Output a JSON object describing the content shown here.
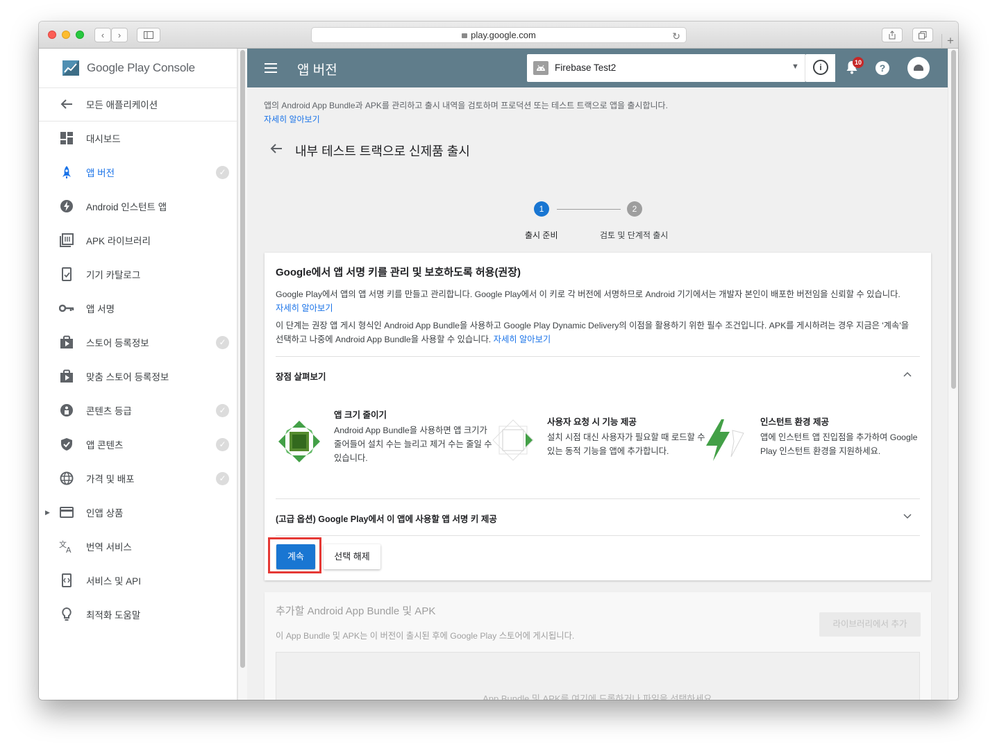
{
  "browser": {
    "url": "play.google.com"
  },
  "sidebar": {
    "logo_text": "Google Play Console",
    "back_label": "모든 애플리케이션",
    "items": [
      {
        "label": "대시보드",
        "icon": "dashboard-icon",
        "checked": false,
        "active": false
      },
      {
        "label": "앱 버전",
        "icon": "rocket-icon",
        "checked": true,
        "active": true
      },
      {
        "label": "Android 인스턴트 앱",
        "icon": "bolt-icon",
        "checked": false,
        "active": false
      },
      {
        "label": "APK 라이브러리",
        "icon": "library-icon",
        "checked": false,
        "active": false
      },
      {
        "label": "기기 카탈로그",
        "icon": "device-catalog-icon",
        "checked": false,
        "active": false
      },
      {
        "label": "앱 서명",
        "icon": "key-icon",
        "checked": false,
        "active": false
      },
      {
        "label": "스토어 등록정보",
        "icon": "store-icon",
        "checked": true,
        "active": false
      },
      {
        "label": "맞춤 스토어 등록정보",
        "icon": "store-icon",
        "checked": false,
        "active": false
      },
      {
        "label": "콘텐츠 등급",
        "icon": "content-rating-icon",
        "checked": true,
        "active": false
      },
      {
        "label": "앱 콘텐츠",
        "icon": "shield-icon",
        "checked": true,
        "active": false
      },
      {
        "label": "가격 및 배포",
        "icon": "globe-icon",
        "checked": true,
        "active": false
      },
      {
        "label": "인앱 상품",
        "icon": "credit-card-icon",
        "checked": false,
        "active": false
      },
      {
        "label": "번역 서비스",
        "icon": "translate-icon",
        "checked": false,
        "active": false
      },
      {
        "label": "서비스 및 API",
        "icon": "api-icon",
        "checked": false,
        "active": false
      },
      {
        "label": "최적화 도움말",
        "icon": "lightbulb-icon",
        "checked": false,
        "active": false
      }
    ]
  },
  "header": {
    "title": "앱 버전",
    "app_name": "Firebase Test2",
    "notification_count": "10"
  },
  "main": {
    "intro": "앱의 Android App Bundle과 APK를 관리하고 출시 내역을 검토하며 프로덕션 또는 테스트 트랙으로 앱을 출시합니다.",
    "intro_link": "자세히 알아보기",
    "page_title": "내부 테스트 트랙으로 신제품 출시",
    "steps": [
      {
        "number": "1",
        "label": "출시 준비"
      },
      {
        "number": "2",
        "label": "검토 및 단계적 출시"
      }
    ],
    "card": {
      "title": "Google에서 앱 서명 키를 관리 및 보호하도록 허용(권장)",
      "para1": "Google Play에서 앱의 앱 서명 키를 만들고 관리합니다. Google Play에서 이 키로 각 버전에 서명하므로 Android 기기에서는 개발자 본인이 배포한 버전임을 신뢰할 수 있습니다.",
      "para1_link": "자세히 알아보기",
      "para2": "이 단계는 권장 앱 게시 형식인 Android App Bundle을 사용하고 Google Play Dynamic Delivery의 이점을 활용하기 위한 필수 조건입니다. APK를 게시하려는 경우 지금은 '계속'을 선택하고 나중에 Android App Bundle을 사용할 수 있습니다.",
      "para2_link": "자세히 알아보기",
      "benefits_title": "장점 살펴보기",
      "features": [
        {
          "title": "앱 크기 줄이기",
          "text": "Android App Bundle을 사용하면 앱 크기가 줄어들어 설치 수는 늘리고 제거 수는 줄일 수 있습니다."
        },
        {
          "title": "사용자 요청 시 기능 제공",
          "text": "설치 시점 대신 사용자가 필요할 때 로드할 수 있는 동적 기능을 앱에 추가합니다."
        },
        {
          "title": "인스턴트 환경 제공",
          "text": "앱에 인스턴트 앱 진입점을 추가하여 Google Play 인스턴트 환경을 지원하세요."
        }
      ],
      "advanced_title": "(고급 옵션) Google Play에서 이 앱에 사용할 앱 서명 키 제공",
      "continue_label": "계속",
      "deselect_label": "선택 해제"
    },
    "card2": {
      "title": "추가할 Android App Bundle 및 APK",
      "subtitle": "이 App Bundle 및 APK는 이 버전이 출시된 후에 Google Play 스토어에 게시됩니다.",
      "library_button": "라이브러리에서 추가",
      "drop_text": "App Bundle 및 APK를 여기에 드롭하거나 파일을 선택하세요."
    }
  },
  "colors": {
    "topbar": "#607d8b",
    "accent": "#1a73e8",
    "primary_button": "#1976d2",
    "highlight": "#e53935"
  }
}
